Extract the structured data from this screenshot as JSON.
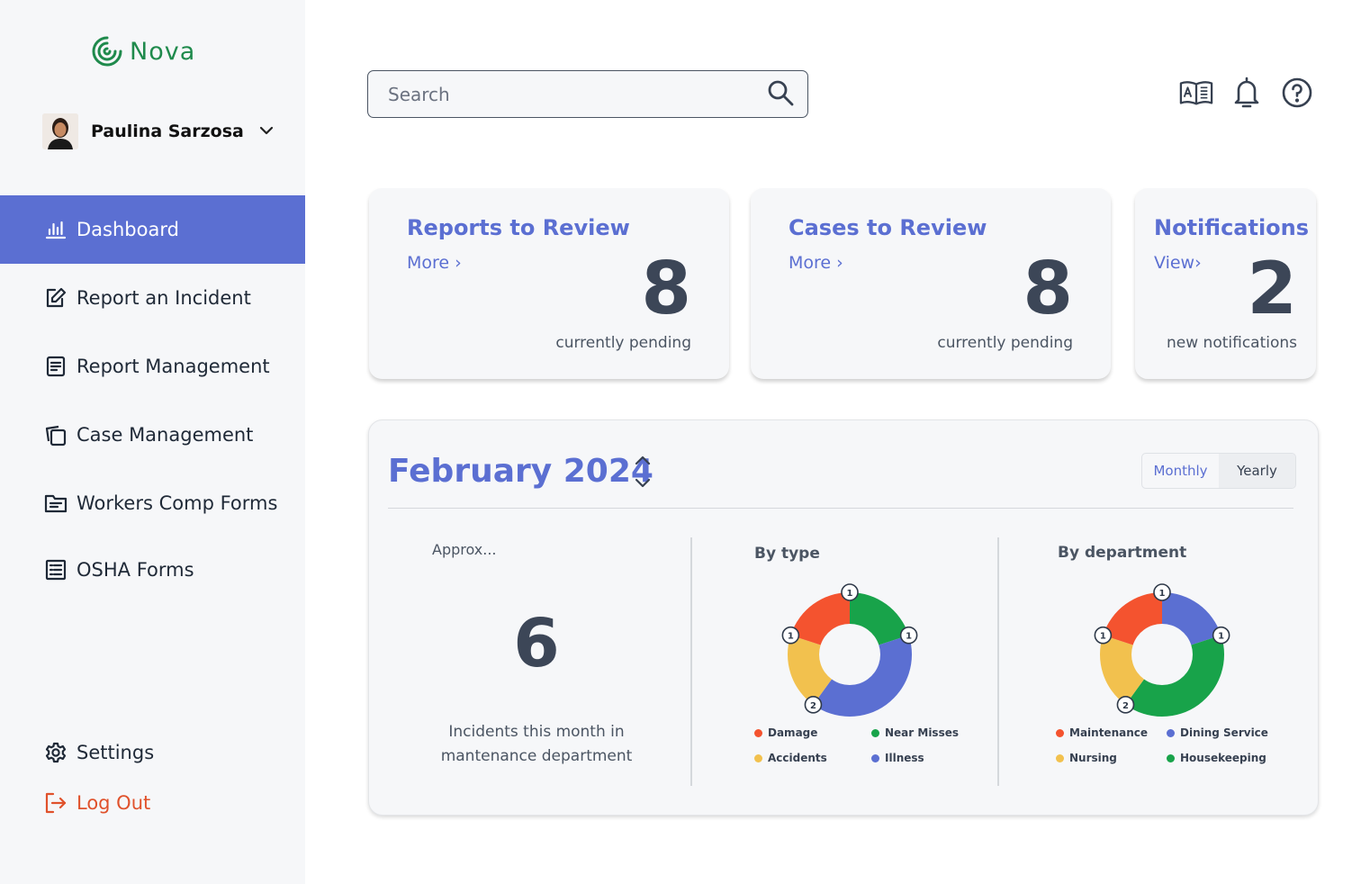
{
  "app": {
    "name": "Nova",
    "brand_color": "#1f8a4c",
    "accent": "#5b6fd2"
  },
  "user": {
    "name": "Paulina Sarzosa"
  },
  "sidebar": {
    "items": [
      {
        "label": "Dashboard",
        "icon": "bar-chart-icon",
        "active": true
      },
      {
        "label": "Report an Incident",
        "icon": "edit-icon"
      },
      {
        "label": "Report Management",
        "icon": "document-icon"
      },
      {
        "label": "Case Management",
        "icon": "copy-icon"
      },
      {
        "label": "Workers Comp Forms",
        "icon": "folder-icon"
      },
      {
        "label": "OSHA Forms",
        "icon": "list-icon"
      }
    ],
    "settings": "Settings",
    "logout": "Log Out"
  },
  "search": {
    "placeholder": "Search"
  },
  "cards": {
    "reports": {
      "title": "Reports to Review",
      "link": "More ›",
      "value": "8",
      "sub": "currently pending"
    },
    "cases": {
      "title": "Cases to Review",
      "link": "More ›",
      "value": "8",
      "sub": "currently pending"
    },
    "notifications": {
      "title": "Notifications",
      "link": "View›",
      "value": "2",
      "sub": "new notifications"
    }
  },
  "panel": {
    "month": "February 2024",
    "toggle": {
      "monthly": "Monthly",
      "yearly": "Yearly",
      "selected": "Yearly"
    },
    "summary": {
      "approx": "Approx...",
      "value": "6",
      "caption": "Incidents this month in mantenance department"
    },
    "by_type_title": "By type",
    "by_department_title": "By department"
  },
  "chart_data": [
    {
      "type": "pie",
      "title": "By type",
      "categories": [
        "Damage",
        "Near Misses",
        "Illness",
        "Accidents"
      ],
      "values": [
        1,
        1,
        2,
        1
      ],
      "colors": [
        "#f4532f",
        "#18a34a",
        "#5b6fd2",
        "#f2c14e"
      ]
    },
    {
      "type": "pie",
      "title": "By department",
      "categories": [
        "Maintenance",
        "Dining Service",
        "Housekeeping",
        "Nursing"
      ],
      "values": [
        1,
        1,
        2,
        1
      ],
      "colors": [
        "#f4532f",
        "#5b6fd2",
        "#18a34a",
        "#f2c14e"
      ]
    }
  ]
}
